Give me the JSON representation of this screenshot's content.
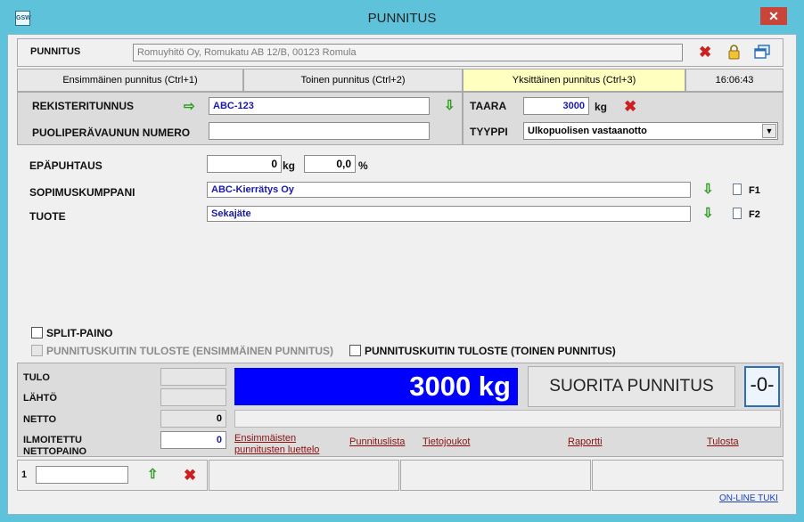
{
  "window": {
    "title": "PUNNITUS",
    "icon_text": "GSW",
    "close_glyph": "✕"
  },
  "header": {
    "label": "PUNNITUS",
    "address_value": "Romuyhitö Oy, Romukatu AB 12/B, 00123 Romula"
  },
  "tabs": [
    {
      "label": "Ensimmäinen punnitus (Ctrl+1)"
    },
    {
      "label": "Toinen punnitus (Ctrl+2)"
    },
    {
      "label": "Yksittäinen punnitus (Ctrl+3)"
    }
  ],
  "clock": "16:06:43",
  "vehicle": {
    "reg_label": "REKISTERITUNNUS",
    "reg_value": "ABC-123",
    "trailer_label": "PUOLIPERÄVAUNUN NUMERO",
    "trailer_value": "",
    "tare_label": "TAARA",
    "tare_value": "3000",
    "tare_unit": "kg",
    "type_label": "TYYPPI",
    "type_value": "Ulkopuolisen vastaanotto"
  },
  "details": {
    "impurity_label": "EPÄPUHTAUS",
    "impurity_kg": "0",
    "impurity_kg_unit": "kg",
    "impurity_pct": "0,0",
    "impurity_pct_unit": "%",
    "partner_label": "SOPIMUSKUMPPANI",
    "partner_value": "ABC-Kierrätys Oy",
    "partner_key": "F1",
    "product_label": "TUOTE",
    "product_value": "Sekajäte",
    "product_key": "F2"
  },
  "options": {
    "split_label": "SPLIT-PAINO",
    "split_checked": false,
    "receipt_first_label": "PUNNITUSKUITIN TULOSTE (ENSIMMÄINEN PUNNITUS)",
    "receipt_first_checked": false,
    "receipt_second_label": "PUNNITUSKUITIN TULOSTE (TOINEN PUNNITUS)",
    "receipt_second_checked": false
  },
  "weights": {
    "in_label": "TULO",
    "in_value": "",
    "out_label": "LÄHTÖ",
    "out_value": "",
    "net_label": "NETTO",
    "net_value": "0",
    "reported_label_1": "ILMOITETTU",
    "reported_label_2": "NETTOPAINO",
    "reported_value": "0"
  },
  "scale": {
    "display": "3000 kg",
    "weigh_button": "SUORITA PUNNITUS",
    "zero_button": "-0-"
  },
  "links": {
    "first_list_1": "Ensimmäisten",
    "first_list_2": "punnitusten luettelo",
    "weigh_list": "Punnituslista",
    "datasets": "Tietojoukot",
    "report": "Raportti",
    "print": "Tulosta"
  },
  "footer": {
    "counter_label": "1",
    "counter_value": "",
    "online_support": "ON-LINE TUKI"
  },
  "colors": {
    "window_frame": "#5ec3da",
    "active_tab": "#ffffc0",
    "scale_display": "#0000ff",
    "link": "#8a1010",
    "close_button": "#c9453a"
  }
}
